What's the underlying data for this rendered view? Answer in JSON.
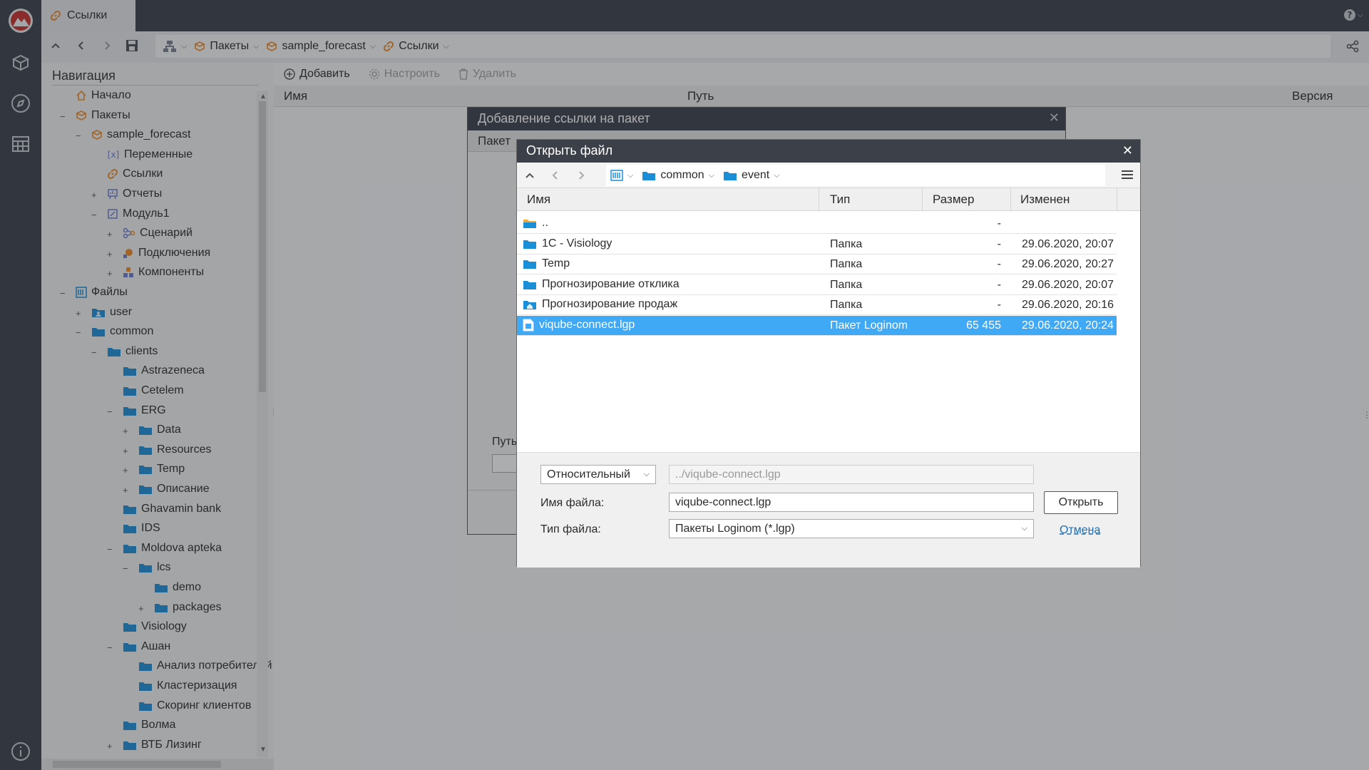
{
  "app": {
    "tab_title": "Ссылки"
  },
  "breadcrumbs": [
    {
      "label": "Пакеты"
    },
    {
      "label": "sample_forecast"
    },
    {
      "label": "Ссылки"
    }
  ],
  "navigation": {
    "title": "Навигация",
    "tree": [
      {
        "label": "Начало"
      },
      {
        "label": "Пакеты"
      },
      {
        "label": "sample_forecast"
      },
      {
        "label": "Переменные"
      },
      {
        "label": "Ссылки"
      },
      {
        "label": "Отчеты"
      },
      {
        "label": "Модуль1"
      },
      {
        "label": "Сценарий"
      },
      {
        "label": "Подключения"
      },
      {
        "label": "Компоненты"
      },
      {
        "label": "Файлы"
      },
      {
        "label": "user"
      },
      {
        "label": "common"
      },
      {
        "label": "clients"
      },
      {
        "label": "Astrazeneca"
      },
      {
        "label": "Cetelem"
      },
      {
        "label": "ERG"
      },
      {
        "label": "Data"
      },
      {
        "label": "Resources"
      },
      {
        "label": "Temp"
      },
      {
        "label": "Описание"
      },
      {
        "label": "Ghavamin bank"
      },
      {
        "label": "IDS"
      },
      {
        "label": "Moldova apteka"
      },
      {
        "label": "lcs"
      },
      {
        "label": "demo"
      },
      {
        "label": "packages"
      },
      {
        "label": "Visiology"
      },
      {
        "label": "Ашан"
      },
      {
        "label": "Анализ потребителей"
      },
      {
        "label": "Кластеризация"
      },
      {
        "label": "Скоринг клиентов"
      },
      {
        "label": "Волма"
      },
      {
        "label": "ВТБ Лизинг"
      }
    ]
  },
  "main": {
    "actions": {
      "add": "Добавить",
      "configure": "Настроить",
      "delete": "Удалить"
    },
    "columns": {
      "name": "Имя",
      "path": "Путь",
      "version": "Версия"
    }
  },
  "dialog_add_link": {
    "title": "Добавление ссылки на пакет",
    "col_package": "Пакет",
    "path_label": "Путь"
  },
  "dialog_open_file": {
    "title": "Открыть файл",
    "path": [
      {
        "label": "common"
      },
      {
        "label": "event"
      }
    ],
    "columns": {
      "name": "Имя",
      "type": "Тип",
      "size": "Размер",
      "modified": "Изменен"
    },
    "rows": [
      {
        "name": "..",
        "type": "",
        "size": "-",
        "modified": "",
        "icon": "folder-up-icon"
      },
      {
        "name": "1C - Visiology",
        "type": "Папка",
        "size": "-",
        "modified": "29.06.2020, 20:07",
        "icon": "folder-icon"
      },
      {
        "name": "Temp",
        "type": "Папка",
        "size": "-",
        "modified": "29.06.2020, 20:27",
        "icon": "folder-icon"
      },
      {
        "name": "Прогнозирование отклика",
        "type": "Папка",
        "size": "-",
        "modified": "29.06.2020, 20:07",
        "icon": "folder-icon"
      },
      {
        "name": "Прогнозирование продаж",
        "type": "Папка",
        "size": "-",
        "modified": "29.06.2020, 20:16",
        "icon": "folder-home-icon"
      },
      {
        "name": "viqube-connect.lgp",
        "type": "Пакет Loginom",
        "size": "65 455",
        "modified": "29.06.2020, 20:24",
        "icon": "package-file-icon",
        "selected": true
      }
    ],
    "path_mode": "Относительный",
    "relative_path": "../viqube-connect.lgp",
    "filename_label": "Имя файла:",
    "filename_value": "viqube-connect.lgp",
    "filetype_label": "Тип файла:",
    "filetype_value": "Пакеты Loginom (*.lgp)",
    "open_button": "Открыть",
    "cancel_link": "Отмена"
  },
  "colors": {
    "sidebar_bg": "#3b4049",
    "selection": "#3fa9f5",
    "folder": "#1a8fd8",
    "accent_orange": "#f08a24"
  }
}
